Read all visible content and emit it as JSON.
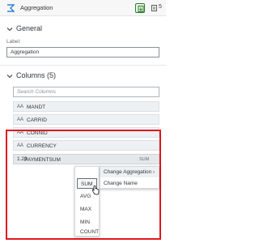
{
  "header": {
    "title": "Aggregation",
    "count": "5",
    "icons": {
      "object": "aggregation-node-icon",
      "add": "add-output-icon",
      "details": "details-icon"
    }
  },
  "general": {
    "title": "General",
    "label_caption": "Label:",
    "label_value": "Aggregation"
  },
  "columns": {
    "title": "Columns (5)",
    "search_placeholder": "Search Columns",
    "items": [
      {
        "type_icon": "AA",
        "name": "MANDT"
      },
      {
        "type_icon": "AA",
        "name": "CARRID"
      },
      {
        "type_icon": "AA",
        "name": "CONNID"
      },
      {
        "type_icon": "AA",
        "name": "CURRENCY"
      }
    ],
    "measure": {
      "type_icon": "1.23",
      "name": "PAYMENTSUM",
      "aggregation": "SUM"
    }
  },
  "context_menu": {
    "items": [
      {
        "label": "Change Aggregation",
        "submenu": true
      },
      {
        "label": "Change Name",
        "submenu": false
      }
    ]
  },
  "aggregation_menu": {
    "items": [
      "SUM",
      "AVG",
      "MAX",
      "MIN",
      "COUNT"
    ],
    "selected": "SUM"
  },
  "colors": {
    "highlight": "#e3161e",
    "accent_green": "#2b7c2b",
    "row_bg": "#eef1f3"
  }
}
